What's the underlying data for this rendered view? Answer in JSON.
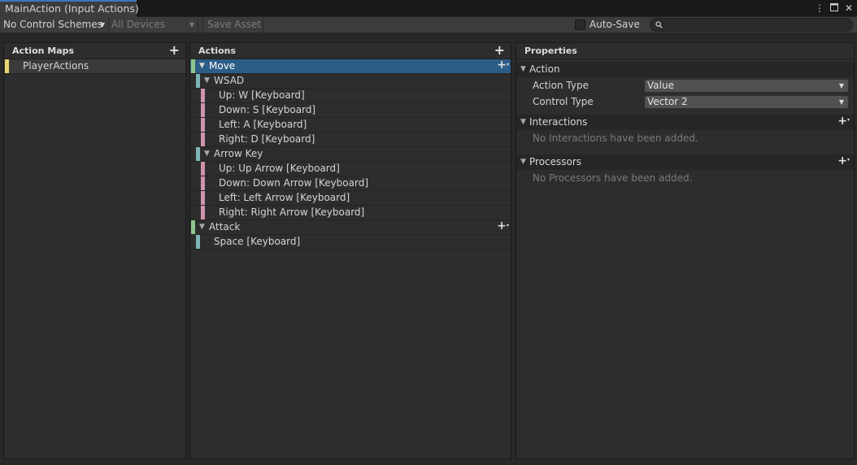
{
  "window": {
    "tab_title": "MainAction (Input Actions)",
    "menu_icon": "vertical-dots-icon",
    "maximize_icon": "maximize-icon",
    "close_icon": "close-icon"
  },
  "toolbar": {
    "control_schemes": "No Control Schemes",
    "devices": "All Devices",
    "save_asset": "Save Asset",
    "auto_save": "Auto-Save",
    "auto_save_checked": false,
    "search_value": ""
  },
  "action_maps": {
    "header": "Action Maps",
    "items": [
      {
        "label": "PlayerActions",
        "color": "#e8d66f"
      }
    ]
  },
  "actions": {
    "header": "Actions",
    "rows": [
      {
        "kind": "action",
        "label": "Move",
        "selected": true,
        "color": "#8fc58a"
      },
      {
        "kind": "composite",
        "label": "WSAD",
        "color": "#7fb4b6"
      },
      {
        "kind": "part",
        "label": "Up: W [Keyboard]",
        "color": "#cf93ad"
      },
      {
        "kind": "part",
        "label": "Down: S [Keyboard]",
        "color": "#cf93ad"
      },
      {
        "kind": "part",
        "label": "Left: A [Keyboard]",
        "color": "#cf93ad"
      },
      {
        "kind": "part",
        "label": "Right: D [Keyboard]",
        "color": "#cf93ad"
      },
      {
        "kind": "composite",
        "label": "Arrow Key",
        "color": "#7fb4b6"
      },
      {
        "kind": "part",
        "label": "Up: Up Arrow [Keyboard]",
        "color": "#cf93ad"
      },
      {
        "kind": "part",
        "label": "Down: Down Arrow [Keyboard]",
        "color": "#cf93ad"
      },
      {
        "kind": "part",
        "label": "Left: Left Arrow [Keyboard]",
        "color": "#cf93ad"
      },
      {
        "kind": "part",
        "label": "Right: Right Arrow [Keyboard]",
        "color": "#cf93ad"
      },
      {
        "kind": "action",
        "label": "Attack",
        "selected": false,
        "color": "#8fc58a"
      },
      {
        "kind": "binding",
        "label": "Space [Keyboard]",
        "color": "#7fb4b6"
      }
    ]
  },
  "properties": {
    "header": "Properties",
    "action_section": "Action",
    "action_type_label": "Action Type",
    "action_type_value": "Value",
    "control_type_label": "Control Type",
    "control_type_value": "Vector 2",
    "interactions_section": "Interactions",
    "interactions_empty": "No Interactions have been added.",
    "processors_section": "Processors",
    "processors_empty": "No Processors have been added."
  }
}
